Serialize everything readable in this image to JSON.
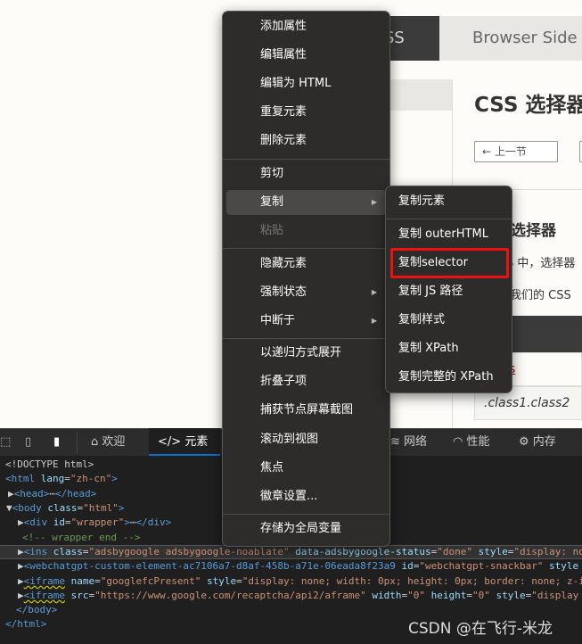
{
  "page": {
    "tab_active_partial": "SS",
    "tab_other": "Browser Side",
    "title": "CSS 选择器",
    "prev_button": "← 上一节",
    "section_title": "选择器",
    "para1": "S 中，选择器",
    "para2": "我们的 CSS",
    "table_header": "器",
    "row1": "s",
    "row2": ".class1.class2"
  },
  "devtools": {
    "tabs": [
      {
        "label": "欢迎",
        "icon": "home-icon"
      },
      {
        "label": "元素",
        "icon": "code-icon"
      },
      {
        "label": "网络",
        "icon": "wifi-icon"
      },
      {
        "label": "性能",
        "icon": "gauge-icon"
      },
      {
        "label": "内存",
        "icon": "chip-icon"
      }
    ],
    "code": {
      "l1": "<!DOCTYPE html>",
      "l2_tag": "<html",
      "l2_attr": " lang",
      "l2_val": "\"zh-cn\"",
      "l2_end": ">",
      "l3_open": "<head>",
      "l3_close": "</head>",
      "l4_tag": "<body",
      "l4_attr": " class",
      "l4_val": "\"html\"",
      "l4_end": ">",
      "l5_tag": "<div",
      "l5_attr": " id",
      "l5_val": "\"wrapper\"",
      "l5_end": ">",
      "l5_close": "</div>",
      "l6": "<!-- wrapper end -->",
      "l7_tag": "<ins",
      "l7_a1": " class",
      "l7_v1": "\"adsbygoogle adsbygoogle-noablate\"",
      "l7_a2": " data-adsbygoogle-status",
      "l7_v2": "\"done\"",
      "l7_a3": " style",
      "l7_v3": "\"display: no",
      "l8_tag": "<webchatgpt-custom-element-ac7106a7-d8af-458b-a71e-06eada8f23a9",
      "l8_a1": " id",
      "l8_v1": "\"webchatgpt-snackbar\"",
      "l8_a2": " style",
      "l9_tag": "<iframe",
      "l9_a1": " name",
      "l9_v1": "\"googlefcPresent\"",
      "l9_a2": " style",
      "l9_v2": "\"display: none; width: 0px; height: 0px; border: none; z-i",
      "l10_tag": "<iframe",
      "l10_a1": " src",
      "l10_v1": "\"https://www.google.com/recaptcha/api2/aframe\"",
      "l10_a2": " width",
      "l10_v2": "\"0\"",
      "l10_a3": " height",
      "l10_v3": "\"0\"",
      "l10_a4": " style",
      "l10_v4": "\"display",
      "l11": "</body>",
      "l12": "</html>"
    }
  },
  "context_menu": {
    "items": [
      "添加属性",
      "编辑属性",
      "编辑为 HTML",
      "重复元素",
      "删除元素",
      "剪切",
      "复制",
      "粘贴",
      "隐藏元素",
      "强制状态",
      "中断于",
      "以递归方式展开",
      "折叠子项",
      "捕获节点屏幕截图",
      "滚动到视图",
      "焦点",
      "徽章设置...",
      "存储为全局变量"
    ]
  },
  "submenu": {
    "items": [
      "复制元素",
      "复制 outerHTML",
      "复制selector",
      "复制 JS 路径",
      "复制样式",
      "复制 XPath",
      "复制完整的 XPath"
    ],
    "highlight_color": "#ee1111"
  },
  "watermark": "CSDN @在飞行-米龙"
}
